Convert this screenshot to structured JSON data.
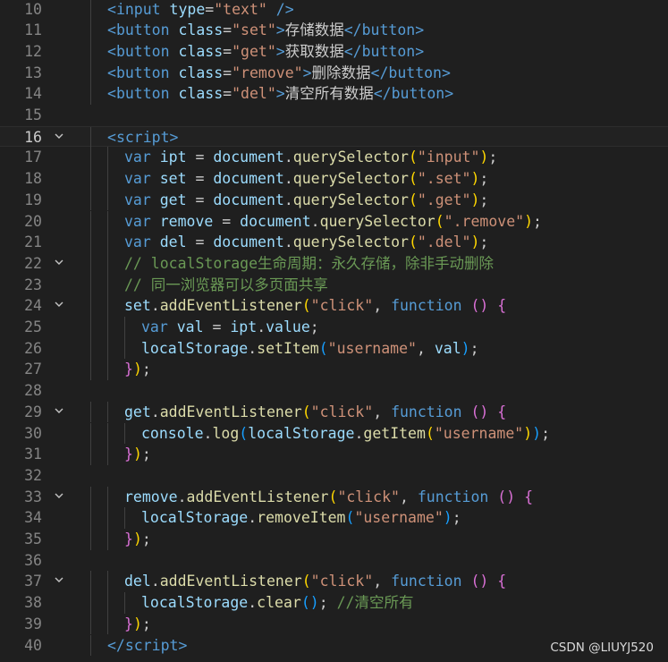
{
  "colors": {
    "background": "#1f1f1f",
    "line_number": "#858585",
    "tag": "#569cd6",
    "attr": "#9cdcfe",
    "string": "#ce9178",
    "plain": "#cccccc",
    "keyword": "#569cd6",
    "variable": "#9cdcfe",
    "function": "#dcdcaa",
    "comment": "#6a9955",
    "paren1": "#ffd700",
    "paren2": "#da70d6",
    "paren3": "#179fff"
  },
  "watermark": "CSDN @LIUYJ520",
  "current_line": 16,
  "lines": [
    {
      "n": "10",
      "fold": false,
      "indent": 1,
      "tokens": [
        [
          "<",
          "tag"
        ],
        [
          "input ",
          "tag"
        ],
        [
          "type",
          "attr"
        ],
        [
          "=",
          "plain"
        ],
        [
          "\"text\"",
          "string"
        ],
        [
          " />",
          "tag"
        ]
      ]
    },
    {
      "n": "11",
      "fold": false,
      "indent": 1,
      "tokens": [
        [
          "<",
          "tag"
        ],
        [
          "button ",
          "tag"
        ],
        [
          "class",
          "attr"
        ],
        [
          "=",
          "plain"
        ],
        [
          "\"set\"",
          "string"
        ],
        [
          ">",
          "tag"
        ],
        [
          "存储数据",
          "plain"
        ],
        [
          "</",
          "tag"
        ],
        [
          "button",
          "tag"
        ],
        [
          ">",
          "tag"
        ]
      ]
    },
    {
      "n": "12",
      "fold": false,
      "indent": 1,
      "tokens": [
        [
          "<",
          "tag"
        ],
        [
          "button ",
          "tag"
        ],
        [
          "class",
          "attr"
        ],
        [
          "=",
          "plain"
        ],
        [
          "\"get\"",
          "string"
        ],
        [
          ">",
          "tag"
        ],
        [
          "获取数据",
          "plain"
        ],
        [
          "</",
          "tag"
        ],
        [
          "button",
          "tag"
        ],
        [
          ">",
          "tag"
        ]
      ]
    },
    {
      "n": "13",
      "fold": false,
      "indent": 1,
      "tokens": [
        [
          "<",
          "tag"
        ],
        [
          "button ",
          "tag"
        ],
        [
          "class",
          "attr"
        ],
        [
          "=",
          "plain"
        ],
        [
          "\"remove\"",
          "string"
        ],
        [
          ">",
          "tag"
        ],
        [
          "删除数据",
          "plain"
        ],
        [
          "</",
          "tag"
        ],
        [
          "button",
          "tag"
        ],
        [
          ">",
          "tag"
        ]
      ]
    },
    {
      "n": "14",
      "fold": false,
      "indent": 1,
      "tokens": [
        [
          "<",
          "tag"
        ],
        [
          "button ",
          "tag"
        ],
        [
          "class",
          "attr"
        ],
        [
          "=",
          "plain"
        ],
        [
          "\"del\"",
          "string"
        ],
        [
          ">",
          "tag"
        ],
        [
          "清空所有数据",
          "plain"
        ],
        [
          "</",
          "tag"
        ],
        [
          "button",
          "tag"
        ],
        [
          ">",
          "tag"
        ]
      ]
    },
    {
      "n": "15",
      "fold": false,
      "indent": 0,
      "tokens": []
    },
    {
      "n": "16",
      "fold": true,
      "indent": 1,
      "tokens": [
        [
          "<",
          "tag"
        ],
        [
          "script",
          "tag"
        ],
        [
          ">",
          "tag"
        ]
      ]
    },
    {
      "n": "17",
      "fold": false,
      "indent": 2,
      "tokens": [
        [
          "var ",
          "keyword"
        ],
        [
          "ipt",
          "variable"
        ],
        [
          " = ",
          "plain"
        ],
        [
          "document",
          "variable"
        ],
        [
          ".",
          "plain"
        ],
        [
          "querySelector",
          "function"
        ],
        [
          "(",
          "paren1"
        ],
        [
          "\"input\"",
          "string"
        ],
        [
          ")",
          "paren1"
        ],
        [
          ";",
          "plain"
        ]
      ]
    },
    {
      "n": "18",
      "fold": false,
      "indent": 2,
      "tokens": [
        [
          "var ",
          "keyword"
        ],
        [
          "set",
          "variable"
        ],
        [
          " = ",
          "plain"
        ],
        [
          "document",
          "variable"
        ],
        [
          ".",
          "plain"
        ],
        [
          "querySelector",
          "function"
        ],
        [
          "(",
          "paren1"
        ],
        [
          "\".set\"",
          "string"
        ],
        [
          ")",
          "paren1"
        ],
        [
          ";",
          "plain"
        ]
      ]
    },
    {
      "n": "19",
      "fold": false,
      "indent": 2,
      "tokens": [
        [
          "var ",
          "keyword"
        ],
        [
          "get",
          "variable"
        ],
        [
          " = ",
          "plain"
        ],
        [
          "document",
          "variable"
        ],
        [
          ".",
          "plain"
        ],
        [
          "querySelector",
          "function"
        ],
        [
          "(",
          "paren1"
        ],
        [
          "\".get\"",
          "string"
        ],
        [
          ")",
          "paren1"
        ],
        [
          ";",
          "plain"
        ]
      ]
    },
    {
      "n": "20",
      "fold": false,
      "indent": 2,
      "tokens": [
        [
          "var ",
          "keyword"
        ],
        [
          "remove",
          "variable"
        ],
        [
          " = ",
          "plain"
        ],
        [
          "document",
          "variable"
        ],
        [
          ".",
          "plain"
        ],
        [
          "querySelector",
          "function"
        ],
        [
          "(",
          "paren1"
        ],
        [
          "\".remove\"",
          "string"
        ],
        [
          ")",
          "paren1"
        ],
        [
          ";",
          "plain"
        ]
      ]
    },
    {
      "n": "21",
      "fold": false,
      "indent": 2,
      "tokens": [
        [
          "var ",
          "keyword"
        ],
        [
          "del",
          "variable"
        ],
        [
          " = ",
          "plain"
        ],
        [
          "document",
          "variable"
        ],
        [
          ".",
          "plain"
        ],
        [
          "querySelector",
          "function"
        ],
        [
          "(",
          "paren1"
        ],
        [
          "\".del\"",
          "string"
        ],
        [
          ")",
          "paren1"
        ],
        [
          ";",
          "plain"
        ]
      ]
    },
    {
      "n": "22",
      "fold": true,
      "indent": 2,
      "tokens": [
        [
          "// localStorage生命周期：永久存储，除非手动删除",
          "comment"
        ]
      ]
    },
    {
      "n": "23",
      "fold": false,
      "indent": 2,
      "tokens": [
        [
          "// 同一浏览器可以多页面共享",
          "comment"
        ]
      ]
    },
    {
      "n": "24",
      "fold": true,
      "indent": 2,
      "tokens": [
        [
          "set",
          "variable"
        ],
        [
          ".",
          "plain"
        ],
        [
          "addEventListener",
          "function"
        ],
        [
          "(",
          "paren1"
        ],
        [
          "\"click\"",
          "string"
        ],
        [
          ", ",
          "plain"
        ],
        [
          "function",
          "keyword"
        ],
        [
          " ",
          "plain"
        ],
        [
          "()",
          "paren2"
        ],
        [
          " ",
          "plain"
        ],
        [
          "{",
          "paren2"
        ]
      ]
    },
    {
      "n": "25",
      "fold": false,
      "indent": 3,
      "tokens": [
        [
          "var ",
          "keyword"
        ],
        [
          "val",
          "variable"
        ],
        [
          " = ",
          "plain"
        ],
        [
          "ipt",
          "variable"
        ],
        [
          ".",
          "plain"
        ],
        [
          "value",
          "variable"
        ],
        [
          ";",
          "plain"
        ]
      ]
    },
    {
      "n": "26",
      "fold": false,
      "indent": 3,
      "tokens": [
        [
          "localStorage",
          "variable"
        ],
        [
          ".",
          "plain"
        ],
        [
          "setItem",
          "function"
        ],
        [
          "(",
          "paren3"
        ],
        [
          "\"username\"",
          "string"
        ],
        [
          ", ",
          "plain"
        ],
        [
          "val",
          "variable"
        ],
        [
          ")",
          "paren3"
        ],
        [
          ";",
          "plain"
        ]
      ]
    },
    {
      "n": "27",
      "fold": false,
      "indent": 2,
      "tokens": [
        [
          "}",
          "paren2"
        ],
        [
          ")",
          "paren1"
        ],
        [
          ";",
          "plain"
        ]
      ]
    },
    {
      "n": "28",
      "fold": false,
      "indent": 0,
      "tokens": []
    },
    {
      "n": "29",
      "fold": true,
      "indent": 2,
      "tokens": [
        [
          "get",
          "variable"
        ],
        [
          ".",
          "plain"
        ],
        [
          "addEventListener",
          "function"
        ],
        [
          "(",
          "paren1"
        ],
        [
          "\"click\"",
          "string"
        ],
        [
          ", ",
          "plain"
        ],
        [
          "function",
          "keyword"
        ],
        [
          " ",
          "plain"
        ],
        [
          "()",
          "paren2"
        ],
        [
          " ",
          "plain"
        ],
        [
          "{",
          "paren2"
        ]
      ]
    },
    {
      "n": "30",
      "fold": false,
      "indent": 3,
      "tokens": [
        [
          "console",
          "variable"
        ],
        [
          ".",
          "plain"
        ],
        [
          "log",
          "function"
        ],
        [
          "(",
          "paren3"
        ],
        [
          "localStorage",
          "variable"
        ],
        [
          ".",
          "plain"
        ],
        [
          "getItem",
          "function"
        ],
        [
          "(",
          "paren1"
        ],
        [
          "\"username\"",
          "string"
        ],
        [
          ")",
          "paren1"
        ],
        [
          ")",
          "paren3"
        ],
        [
          ";",
          "plain"
        ]
      ]
    },
    {
      "n": "31",
      "fold": false,
      "indent": 2,
      "tokens": [
        [
          "}",
          "paren2"
        ],
        [
          ")",
          "paren1"
        ],
        [
          ";",
          "plain"
        ]
      ]
    },
    {
      "n": "32",
      "fold": false,
      "indent": 0,
      "tokens": []
    },
    {
      "n": "33",
      "fold": true,
      "indent": 2,
      "tokens": [
        [
          "remove",
          "variable"
        ],
        [
          ".",
          "plain"
        ],
        [
          "addEventListener",
          "function"
        ],
        [
          "(",
          "paren1"
        ],
        [
          "\"click\"",
          "string"
        ],
        [
          ", ",
          "plain"
        ],
        [
          "function",
          "keyword"
        ],
        [
          " ",
          "plain"
        ],
        [
          "()",
          "paren2"
        ],
        [
          " ",
          "plain"
        ],
        [
          "{",
          "paren2"
        ]
      ]
    },
    {
      "n": "34",
      "fold": false,
      "indent": 3,
      "tokens": [
        [
          "localStorage",
          "variable"
        ],
        [
          ".",
          "plain"
        ],
        [
          "removeItem",
          "function"
        ],
        [
          "(",
          "paren3"
        ],
        [
          "\"username\"",
          "string"
        ],
        [
          ")",
          "paren3"
        ],
        [
          ";",
          "plain"
        ]
      ]
    },
    {
      "n": "35",
      "fold": false,
      "indent": 2,
      "tokens": [
        [
          "}",
          "paren2"
        ],
        [
          ")",
          "paren1"
        ],
        [
          ";",
          "plain"
        ]
      ]
    },
    {
      "n": "36",
      "fold": false,
      "indent": 0,
      "tokens": []
    },
    {
      "n": "37",
      "fold": true,
      "indent": 2,
      "tokens": [
        [
          "del",
          "variable"
        ],
        [
          ".",
          "plain"
        ],
        [
          "addEventListener",
          "function"
        ],
        [
          "(",
          "paren1"
        ],
        [
          "\"click\"",
          "string"
        ],
        [
          ", ",
          "plain"
        ],
        [
          "function",
          "keyword"
        ],
        [
          " ",
          "plain"
        ],
        [
          "()",
          "paren2"
        ],
        [
          " ",
          "plain"
        ],
        [
          "{",
          "paren2"
        ]
      ]
    },
    {
      "n": "38",
      "fold": false,
      "indent": 3,
      "tokens": [
        [
          "localStorage",
          "variable"
        ],
        [
          ".",
          "plain"
        ],
        [
          "clear",
          "function"
        ],
        [
          "()",
          "paren3"
        ],
        [
          ";",
          "plain"
        ],
        [
          " ",
          "plain"
        ],
        [
          "//清空所有",
          "comment"
        ]
      ]
    },
    {
      "n": "39",
      "fold": false,
      "indent": 2,
      "tokens": [
        [
          "}",
          "paren2"
        ],
        [
          ")",
          "paren1"
        ],
        [
          ";",
          "plain"
        ]
      ]
    },
    {
      "n": "40",
      "fold": false,
      "indent": 1,
      "tokens": [
        [
          "</",
          "tag"
        ],
        [
          "script",
          "tag"
        ],
        [
          ">",
          "tag"
        ]
      ]
    }
  ]
}
